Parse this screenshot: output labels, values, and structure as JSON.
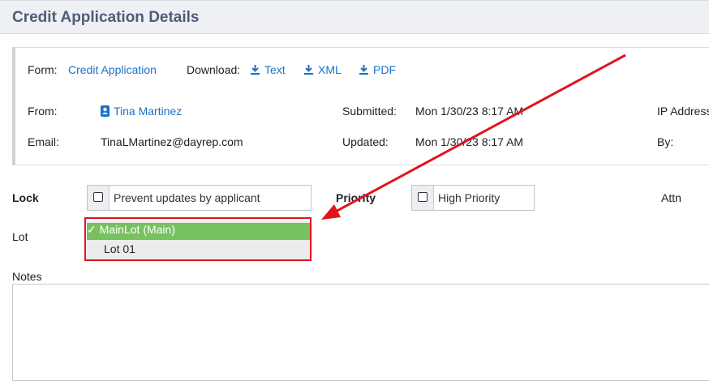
{
  "page": {
    "title": "Credit Application Details"
  },
  "form_row": {
    "form_label": "Form:",
    "form_link": "Credit Application",
    "download_label": "Download:",
    "downloads": [
      {
        "label": "Text",
        "icon": "download-icon"
      },
      {
        "label": "XML",
        "icon": "download-icon"
      },
      {
        "label": "PDF",
        "icon": "download-icon"
      }
    ]
  },
  "details": {
    "from_label": "From:",
    "from_name": "Tina Martinez",
    "from_icon": "contact-card-icon",
    "email_label": "Email:",
    "email_value": "TinaLMartinez@dayrep.com",
    "submitted_label": "Submitted:",
    "submitted_value": "Mon 1/30/23 8:17 AM",
    "updated_label": "Updated:",
    "updated_value": "Mon 1/30/23 8:17 AM",
    "ip_label": "IP Address",
    "by_label": "By:"
  },
  "options": {
    "lock_label": "Lock",
    "lock_checkbox": "Prevent updates by applicant",
    "priority_label": "Priority",
    "priority_checkbox": "High Priority",
    "attn_label": "Attn",
    "lot_label": "Lot",
    "lot_options": [
      {
        "label": "MainLot (Main)",
        "selected": true,
        "check": "✓"
      },
      {
        "label": "Lot 01",
        "selected": false
      }
    ],
    "notes_label": "Notes"
  },
  "colors": {
    "link": "#1a73c8",
    "header_text": "#4e5d78",
    "selected_option": "#77c160",
    "annotation": "#e0141c"
  }
}
